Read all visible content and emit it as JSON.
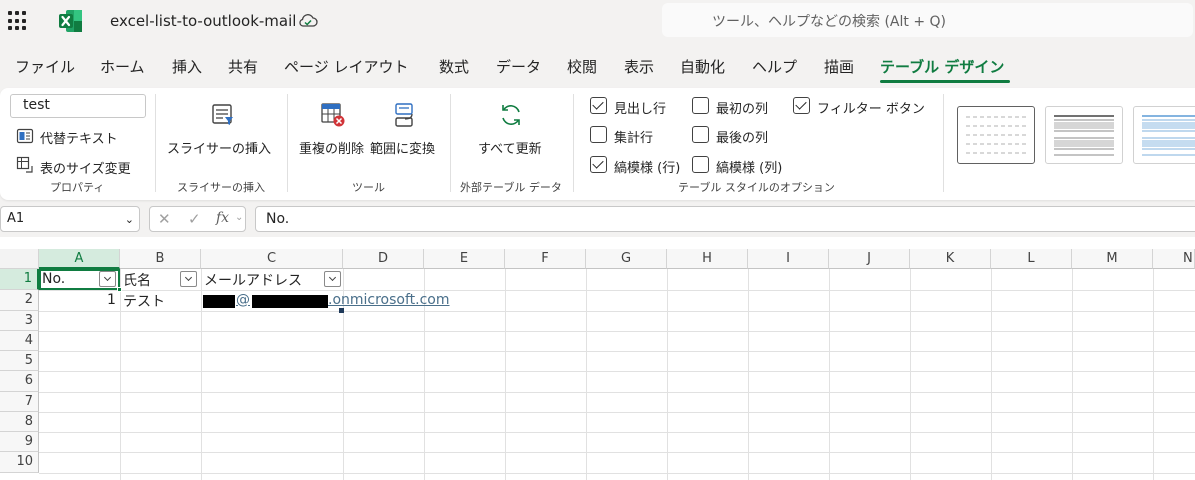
{
  "app": {
    "doc_title": "excel-list-to-outlook-mail",
    "search_placeholder": "ツール、ヘルプなどの検索 (Alt + Q)",
    "brand_color": "#107c41"
  },
  "menu": {
    "tabs": [
      "ファイル",
      "ホーム",
      "挿入",
      "共有",
      "ページ レイアウト",
      "数式",
      "データ",
      "校閲",
      "表示",
      "自動化",
      "ヘルプ",
      "描画",
      "テーブル デザイン"
    ],
    "active": "テーブル デザイン"
  },
  "ribbon": {
    "properties": {
      "table_name": "test",
      "alt_text": "代替テキスト",
      "resize": "表のサイズ変更",
      "label": "プロパティ"
    },
    "slicer": {
      "button": "スライサーの挿入",
      "label": "スライサーの挿入"
    },
    "tools": {
      "remove_duplicates": "重複の削除",
      "convert_range": "範囲に変換",
      "label": "ツール"
    },
    "external": {
      "refresh_all": "すべて更新",
      "label": "外部テーブル データ"
    },
    "style_options": {
      "header_row": {
        "label": "見出し行",
        "checked": true
      },
      "total_row": {
        "label": "集計行",
        "checked": false
      },
      "banded_rows": {
        "label": "縞模様 (行)",
        "checked": true
      },
      "first_column": {
        "label": "最初の列",
        "checked": false
      },
      "last_column": {
        "label": "最後の列",
        "checked": false
      },
      "banded_columns": {
        "label": "縞模様 (列)",
        "checked": false
      },
      "filter_button": {
        "label": "フィルター ボタン",
        "checked": true
      },
      "label": "テーブル スタイルのオプション"
    }
  },
  "formula_bar": {
    "name_box": "A1",
    "fx": "fx",
    "content": "No."
  },
  "sheet": {
    "columns": [
      "A",
      "B",
      "C",
      "D",
      "E",
      "F",
      "G",
      "H",
      "I",
      "J",
      "K",
      "L",
      "M",
      "N"
    ],
    "rows": [
      "1",
      "2",
      "3",
      "4",
      "5",
      "6",
      "7",
      "8",
      "9",
      "10"
    ],
    "headers": {
      "a1": "No.",
      "b1": "氏名",
      "c1": "メールアドレス"
    },
    "row2": {
      "a2": "1",
      "b2": "テスト",
      "c2_at": "@",
      "c2_domain": ".onmicrosoft.com"
    }
  }
}
